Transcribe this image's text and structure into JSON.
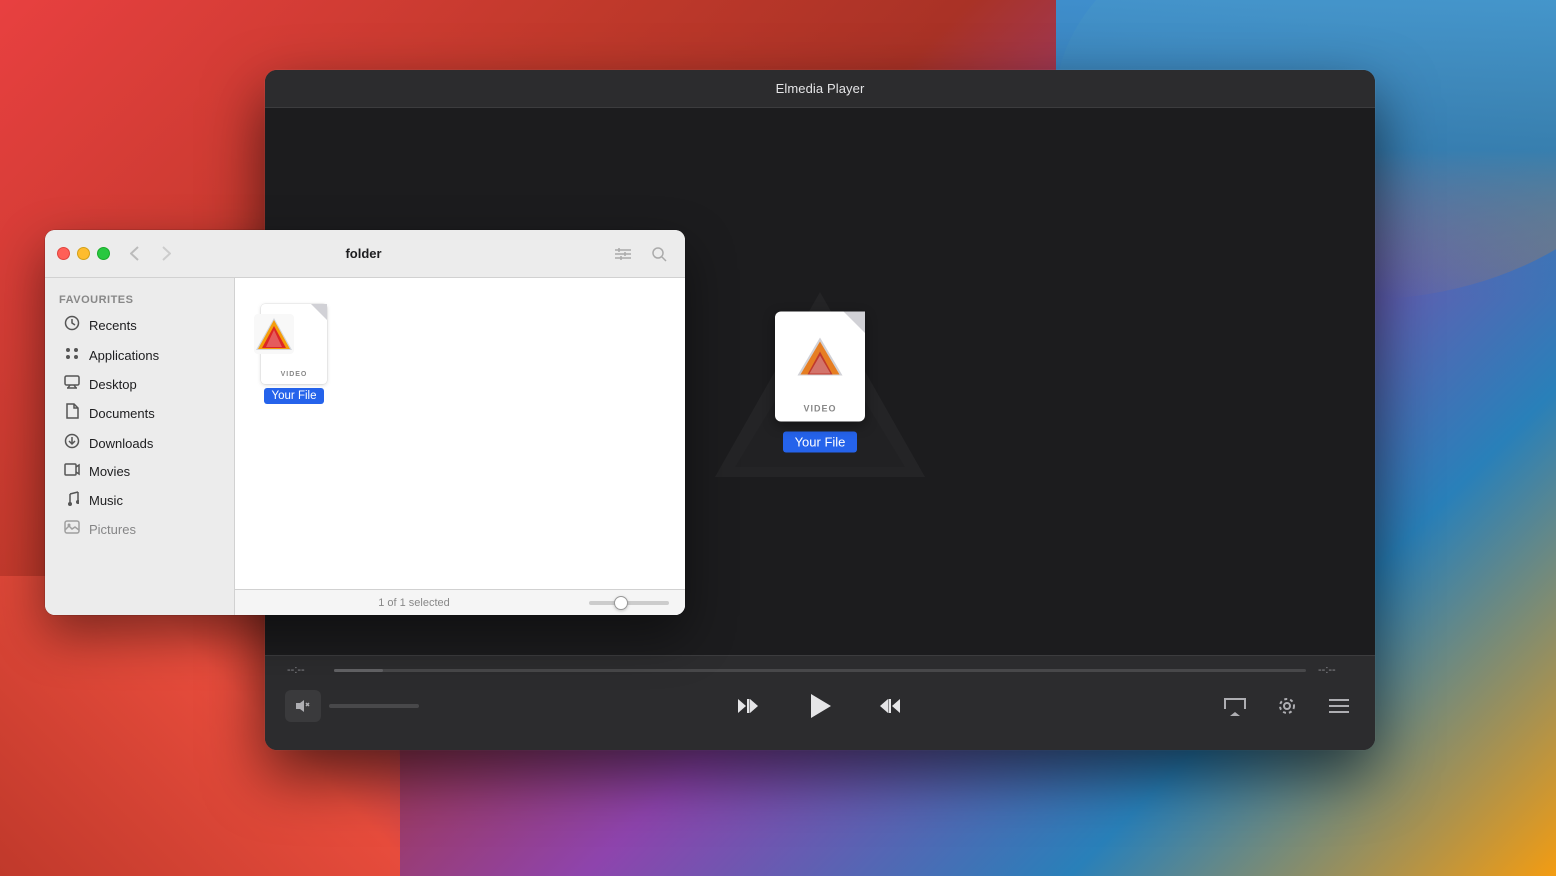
{
  "desktop": {
    "background": "macOS Monterey style gradient"
  },
  "player": {
    "title": "Elmedia Player",
    "file_label": "Your File",
    "video_badge": "VIDEO",
    "time_start": "--:--",
    "time_end": "--:--",
    "controls": {
      "prev_label": "⏮",
      "play_label": "▶",
      "next_label": "⏭",
      "airplay_label": "⏏",
      "settings_label": "⚙",
      "playlist_label": "☰"
    }
  },
  "finder": {
    "title": "folder",
    "status": "1 of 1 selected",
    "sidebar": {
      "section_label": "Favourites",
      "items": [
        {
          "id": "recents",
          "label": "Recents",
          "icon": "🕐"
        },
        {
          "id": "applications",
          "label": "Applications",
          "icon": "🚀"
        },
        {
          "id": "desktop",
          "label": "Desktop",
          "icon": "🖥"
        },
        {
          "id": "documents",
          "label": "Documents",
          "icon": "📄"
        },
        {
          "id": "downloads",
          "label": "Downloads",
          "icon": "⬇"
        },
        {
          "id": "movies",
          "label": "Movies",
          "icon": "🎬"
        },
        {
          "id": "music",
          "label": "Music",
          "icon": "🎵"
        },
        {
          "id": "pictures",
          "label": "Pictures",
          "icon": "🖼"
        }
      ]
    },
    "file": {
      "label": "Your File",
      "video_badge": "VIDEO"
    }
  }
}
